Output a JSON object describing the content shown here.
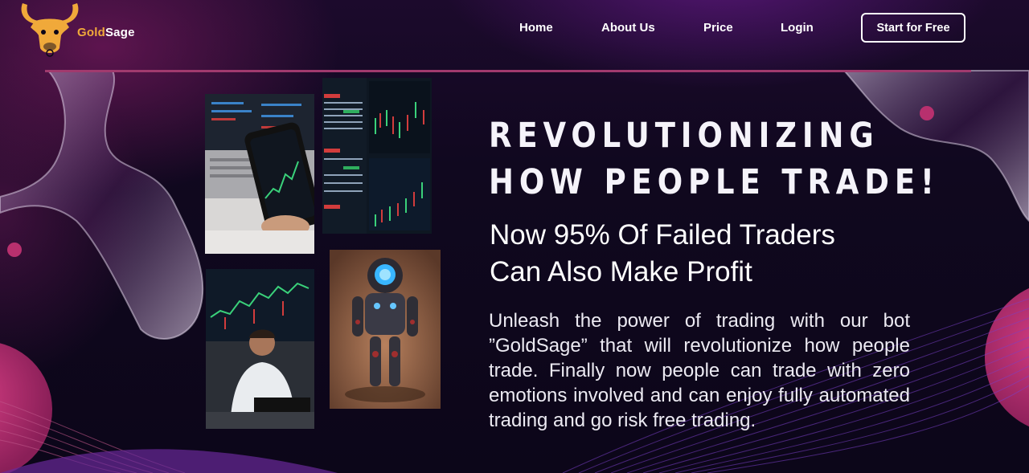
{
  "brand": {
    "name_part1": "Gold",
    "name_part2": "Sage",
    "logo_icon": "bull-head-icon"
  },
  "nav": {
    "home": "Home",
    "about": "About Us",
    "price": "Price",
    "login": "Login",
    "cta": "Start for Free"
  },
  "hero": {
    "headline_line1": "REVOLUTIONIZING",
    "headline_line2": "HOW PEOPLE TRADE!",
    "subhead_line1": "Now 95% Of Failed Traders",
    "subhead_line2": "Can Also Make Profit",
    "paragraph": "Unleash the power of trading with our bot ”GoldSage” that will revolutionize how people trade. Finally now people can trade with zero emotions involved and can enjoy fully automated trading and go risk free trading."
  },
  "colors": {
    "background": "#0c0619",
    "accent_gold": "#f0a93a",
    "divider": "#a13a6e",
    "pink_circle": "#b8306e"
  },
  "images": [
    {
      "name": "phone-trading-photo"
    },
    {
      "name": "trading-screens-photo"
    },
    {
      "name": "trader-at-desk-photo"
    },
    {
      "name": "robot-photo"
    }
  ]
}
